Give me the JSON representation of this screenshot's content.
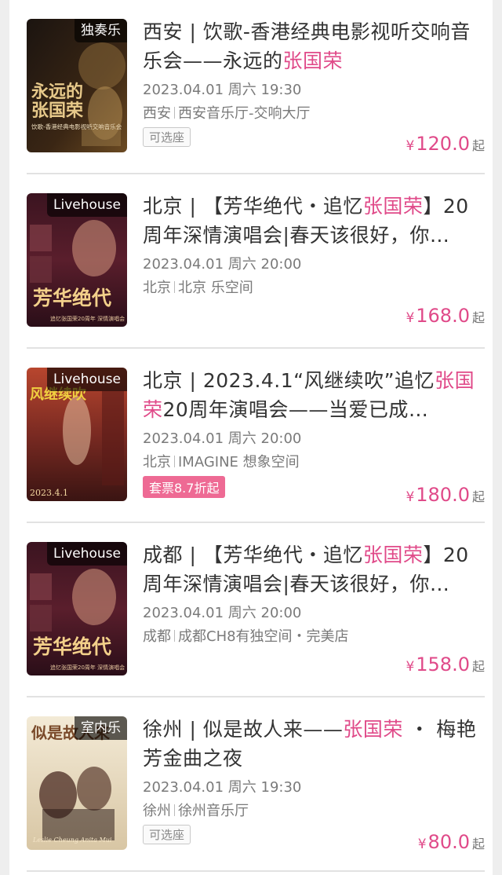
{
  "events": [
    {
      "tag": "独奏乐",
      "title_pre": "西安 | 饮歌-香港经典电影视听交响音乐会——永远的",
      "title_hl": "张国荣",
      "title_post": "",
      "datetime": "2023.04.01 周六 19:30",
      "city": "西安",
      "venue": "西安音乐厅-交响大厅",
      "badge": "可选座",
      "badge_type": "outline",
      "price_symbol": "¥",
      "price": "120.0",
      "price_suffix": "起",
      "poster_text_1": "永远的",
      "poster_text_2": "张国荣",
      "poster_caption": "饮歌-香港经典电影视听交响音乐会"
    },
    {
      "tag": "Livehouse",
      "title_pre": "北京 | 【芳华绝代・追忆",
      "title_hl": "张国荣",
      "title_post": "】20周年深情演唱会|春天该很好，你…",
      "datetime": "2023.04.01 周六 20:00",
      "city": "北京",
      "venue": "北京 乐空间",
      "badge": "",
      "badge_type": "none",
      "price_symbol": "¥",
      "price": "168.0",
      "price_suffix": "起",
      "poster_text_1": "芳华绝代",
      "poster_caption": "追忆张国荣20周年 深情演唱会"
    },
    {
      "tag": "Livehouse",
      "title_pre": "北京 | 2023.4.1“风继续吹”追忆",
      "title_hl": "张国荣",
      "title_post": "20周年演唱会——当爱已成…",
      "datetime": "2023.04.01 周六 20:00",
      "city": "北京",
      "venue": "IMAGINE 想象空间",
      "badge": "套票8.7折起",
      "badge_type": "pink",
      "price_symbol": "¥",
      "price": "180.0",
      "price_suffix": "起",
      "poster_text_1": "风继续吹",
      "poster_caption": "2023.4.1"
    },
    {
      "tag": "Livehouse",
      "title_pre": "成都 | 【芳华绝代・追忆",
      "title_hl": "张国荣",
      "title_post": "】20周年深情演唱会|春天该很好，你…",
      "datetime": "2023.04.01 周六 20:00",
      "city": "成都",
      "venue": "成都CH8有独空间・完美店",
      "badge": "",
      "badge_type": "none",
      "price_symbol": "¥",
      "price": "158.0",
      "price_suffix": "起",
      "poster_text_1": "芳华绝代",
      "poster_caption": "追忆张国荣20周年 深情演唱会"
    },
    {
      "tag": "室内乐",
      "title_pre": "徐州 | 似是故人来——",
      "title_hl": "张国荣",
      "title_post": " ・ 梅艳芳金曲之夜",
      "datetime": "2023.04.01 周六 19:30",
      "city": "徐州",
      "venue": "徐州音乐厅",
      "badge": "可选座",
      "badge_type": "outline",
      "price_symbol": "¥",
      "price": "80.0",
      "price_suffix": "起",
      "poster_text_1": "似是故人来",
      "poster_caption": "Leslie Cheung  Anita Mui"
    }
  ]
}
